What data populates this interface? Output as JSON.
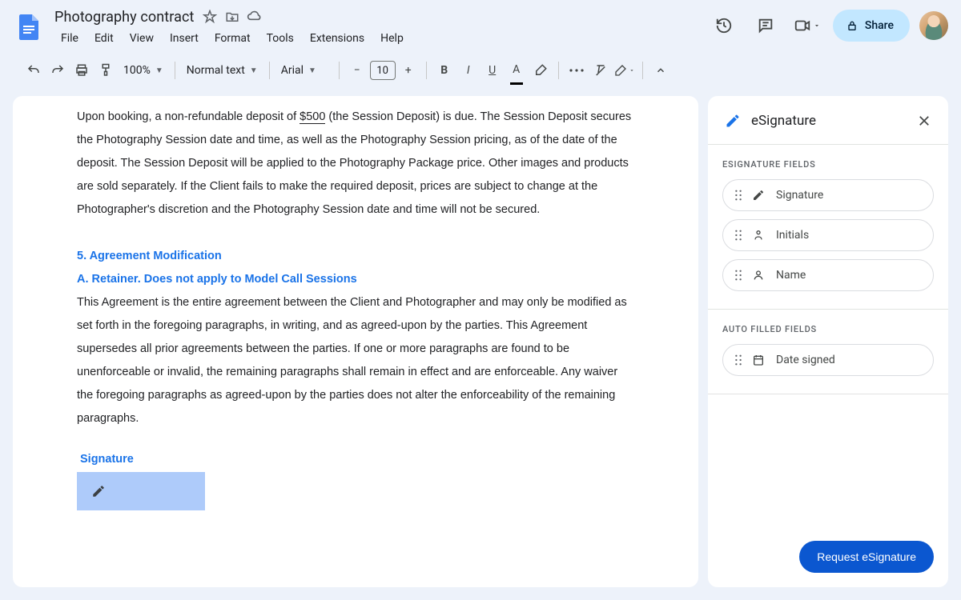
{
  "header": {
    "doc_title": "Photography contract",
    "menus": [
      "File",
      "Edit",
      "View",
      "Insert",
      "Format",
      "Tools",
      "Extensions",
      "Help"
    ],
    "share_label": "Share"
  },
  "toolbar": {
    "zoom": "100%",
    "paragraph_style": "Normal text",
    "font_family": "Arial",
    "font_size": "10"
  },
  "document": {
    "p1_a": "Upon booking, a non-refundable deposit of ",
    "deposit": "$500",
    "p1_b": " (the Session Deposit) is due. The Session Deposit secures the Photography Session date and time, as well as the Photography Session pricing, as of the date of the deposit. The Session Deposit will be applied to the Photography Package price. Other images and products are sold separately. If the Client fails to make the required deposit, prices are subject to change at the Photographer's discretion and the Photography Session date and time will not be secured.",
    "h5": "5. Agreement Modification",
    "h5a": "A. Retainer.  Does not apply to Model Call Sessions",
    "p2": "This Agreement is the entire agreement between the Client and Photographer and may only be modified as set forth in the foregoing paragraphs, in writing, and as agreed-upon by the parties.  This Agreement supersedes all prior agreements between the parties. If one or more paragraphs are found to be unenforceable or invalid, the remaining paragraphs shall remain in effect and are enforceable. Any waiver the foregoing paragraphs as agreed-upon by the parties does not alter the enforceability of the remaining paragraphs.",
    "signature_label": "Signature"
  },
  "panel": {
    "title": "eSignature",
    "section_esig": "eSignature Fields",
    "section_auto": "Auto Filled Fields",
    "fields_esig": [
      "Signature",
      "Initials",
      "Name"
    ],
    "fields_auto": [
      "Date signed"
    ],
    "request_label": "Request eSignature"
  }
}
